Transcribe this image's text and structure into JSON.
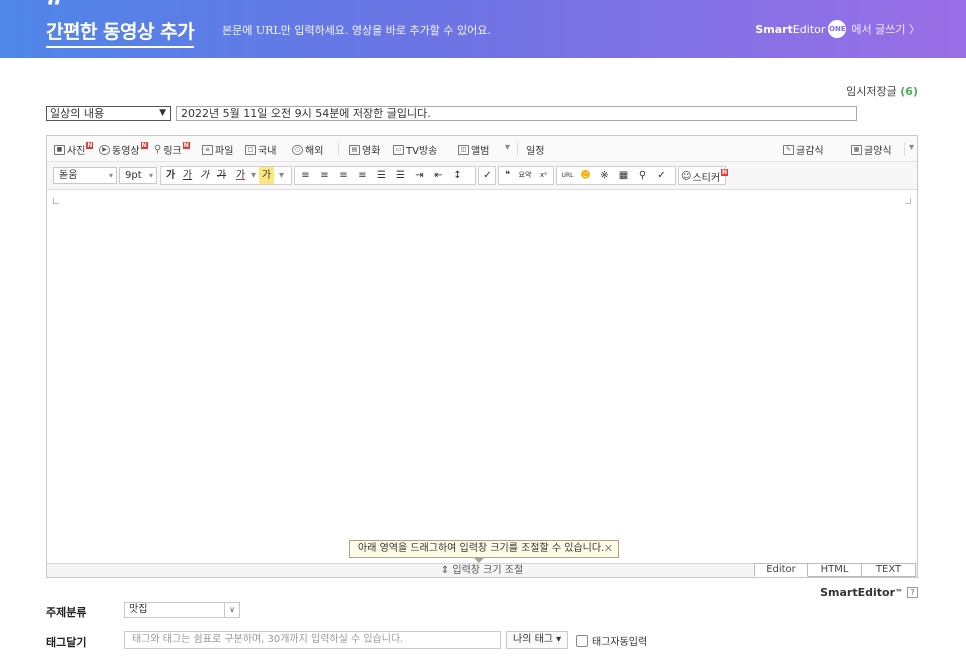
{
  "banner": {
    "quote_mark": "“",
    "title": "간편한 동영상 추가",
    "subtitle": "본문에 URL만 입력하세요. 영상을 바로 추가할 수 있어요.",
    "brand_bold": "Smart",
    "brand_rest": "Editor",
    "brand_one": "ONE",
    "brand_link": "에서 글쓰기 〉"
  },
  "temp_save": {
    "label": "임시저장글",
    "count": "(6)"
  },
  "category": {
    "selected": "일상의 내용",
    "arrow": "▼"
  },
  "save_message": "2022년 5월 11일 오전 9시 54분에 저장한 글입니다.",
  "toolbar1": {
    "photo": "사진",
    "video": "동영상",
    "link": "링크",
    "file": "파일",
    "domestic": "국내",
    "overseas": "해외",
    "movie": "영화",
    "tv": "TV방송",
    "album": "앨범",
    "more_arrow": "▾",
    "schedule": "일정",
    "writing_style": "글감식",
    "template": "글양식"
  },
  "toolbar2": {
    "font": "돋움",
    "size": "9pt",
    "bold": "가",
    "underline": "가",
    "italic": "가",
    "strike": "가",
    "font_color": "가",
    "highlight": "가",
    "quote": "❝",
    "summary": "요약",
    "url": "URL",
    "sticker": "스티커"
  },
  "tooltip": {
    "text": "아래 영역을 드래그하여 입력창 크기를 조절할 수 있습니다.",
    "close": "✕"
  },
  "resize_bar": "⇕ 입력창 크기 조절",
  "mode_tabs": [
    "Editor",
    "HTML",
    "TEXT"
  ],
  "smarteditor_brand": {
    "name": "SmartEditor",
    "tm": "™",
    "help": "?"
  },
  "topic": {
    "label": "주제분류",
    "selected": "맛집",
    "arrow": "∨"
  },
  "tags": {
    "label": "태그달기",
    "placeholder": "태그와 태그는 쉼표로 구분하며, 30개까지 입력하실 수 있습니다.",
    "my_tag": "나의 태그 ▾",
    "auto_tag": "태그자동입력"
  }
}
